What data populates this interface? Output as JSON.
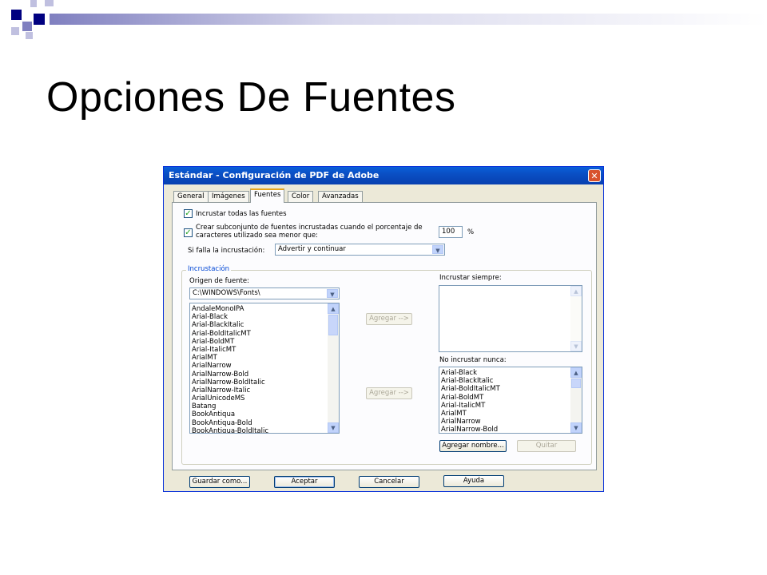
{
  "slide": {
    "title": "Opciones De Fuentes",
    "colors": {
      "navy": "#000080",
      "periwinkle": "#8080c0",
      "lavender": "#c0c0e0"
    }
  },
  "dialog": {
    "title": "Estándar - Configuración de PDF de Adobe",
    "close_icon": "close-icon",
    "tabs": [
      "General",
      "Imágenes",
      "Fuentes",
      "Color",
      "Avanzadas"
    ],
    "active_tab": "Fuentes",
    "embed_all": {
      "label": "Incrustar todas las fuentes",
      "checked": true
    },
    "subset": {
      "label_line1": "Crear subconjunto de fuentes incrustadas cuando el porcentaje de",
      "label_line2": "caracteres utilizado sea menor que:",
      "checked": true,
      "value": "100",
      "unit": "%"
    },
    "on_fail": {
      "label": "Si falla la incrustación:",
      "value": "Advertir y continuar"
    },
    "group": {
      "label": "Incrustación",
      "source_label": "Origen de fuente:",
      "source_value": "C:\\WINDOWS\\Fonts\\",
      "source_fonts": [
        "AndaleMonoIPA",
        "Arial-Black",
        "Arial-BlackItalic",
        "Arial-BoldItalicMT",
        "Arial-BoldMT",
        "Arial-ItalicMT",
        "ArialMT",
        "ArialNarrow",
        "ArialNarrow-Bold",
        "ArialNarrow-BoldItalic",
        "ArialNarrow-Italic",
        "ArialUnicodeMS",
        "Batang",
        "BookAntiqua",
        "BookAntiqua-Bold",
        "BookAntiqua-BoldItalic"
      ],
      "add_button_1": "Agregar -->",
      "add_button_2": "Agregar -->",
      "always_label": "Incrustar siempre:",
      "never_label": "No incrustar nunca:",
      "never_fonts": [
        "Arial-Black",
        "Arial-BlackItalic",
        "Arial-BoldItalicMT",
        "Arial-BoldMT",
        "Arial-ItalicMT",
        "ArialMT",
        "ArialNarrow",
        "ArialNarrow-Bold"
      ],
      "add_name_button": "Agregar nombre...",
      "remove_button": "Quitar"
    },
    "footer": {
      "save_as": "Guardar como...",
      "ok": "Aceptar",
      "cancel": "Cancelar",
      "help": "Ayuda"
    }
  }
}
